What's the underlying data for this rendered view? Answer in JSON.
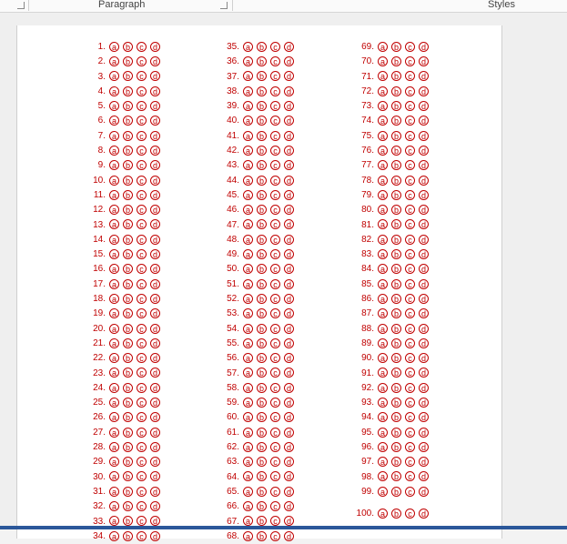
{
  "ribbon": {
    "paragraph_label": "Paragraph",
    "styles_label": "Styles"
  },
  "options": [
    "a",
    "b",
    "c",
    "d"
  ],
  "columns": [
    {
      "start": 1,
      "end": 34
    },
    {
      "start": 35,
      "end": 68
    },
    {
      "start": 69,
      "end": 100
    }
  ],
  "colors": {
    "answer_text": "#c00000",
    "highlight": "#0000c0",
    "statusbar": "#2b579a"
  }
}
